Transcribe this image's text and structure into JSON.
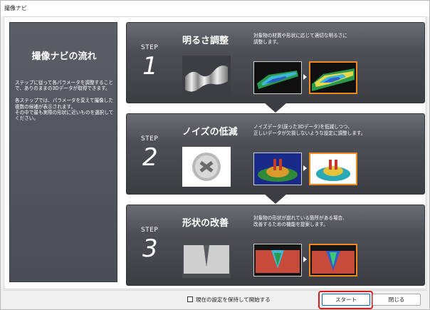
{
  "window": {
    "title": "撮像ナビ"
  },
  "sidebar": {
    "heading": "撮像ナビの流れ",
    "body": "ステップに従って各パラメータを調整することで、ありのままの3Dデータが取得できます。\n\n各ステップでは、パラメータを変えて撮像した複数の候補が表示されます。\nその中で最も実際の形状に近いものを選択してください。"
  },
  "steps": [
    {
      "label": "STEP",
      "number": "1",
      "title": "明るさ調整",
      "description": "対象物の材質や形状に応じて適切な明るさに\n調整します。"
    },
    {
      "label": "STEP",
      "number": "2",
      "title": "ノイズの低減",
      "description": "ノイズデータ(誤った3Dデータ)を低減しつつ、\n正しいデータが欠損しないような設定に調整します。"
    },
    {
      "label": "STEP",
      "number": "3",
      "title": "形状の改善",
      "description": "対象物の形状が崩れている箇所がある場合、\n改善するための機能を提案します。"
    }
  ],
  "footer": {
    "checkbox_label": "現在の設定を保持して開始する",
    "start_button": "スタート",
    "close_button": "閉じる"
  },
  "colors": {
    "highlight": "#d42020",
    "selected_frame": "#f08a1c",
    "panel": "#4a4e56"
  }
}
